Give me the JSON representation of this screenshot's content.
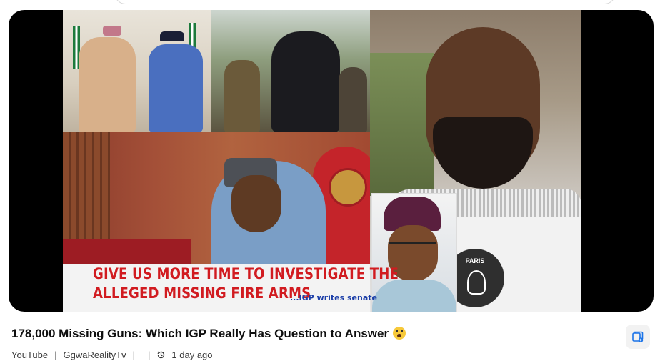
{
  "video": {
    "title": "178,000 Missing Guns: Which IGP Really Has Question to Answer",
    "title_emoji_icon": "face-screaming-in-fear-icon",
    "thumbnail_caption_line1": "GIVE US MORE TIME TO INVESTIGATE THE",
    "thumbnail_caption_line2": "ALLEGED MISSING FIRE ARMS",
    "thumbnail_caption_sub": "...IGP writes senate",
    "thumbnail_badge_text": "PARIS"
  },
  "meta": {
    "source": "YouTube",
    "channel": "GgwaRealityTv",
    "separator": "|",
    "time_icon": "history-clock-icon",
    "age": "1 day ago"
  },
  "actions": {
    "save_icon": "save-to-collection-icon"
  },
  "colors": {
    "caption_red": "#d11b20",
    "caption_blue": "#1b3ea8",
    "player_bg": "#000000"
  }
}
